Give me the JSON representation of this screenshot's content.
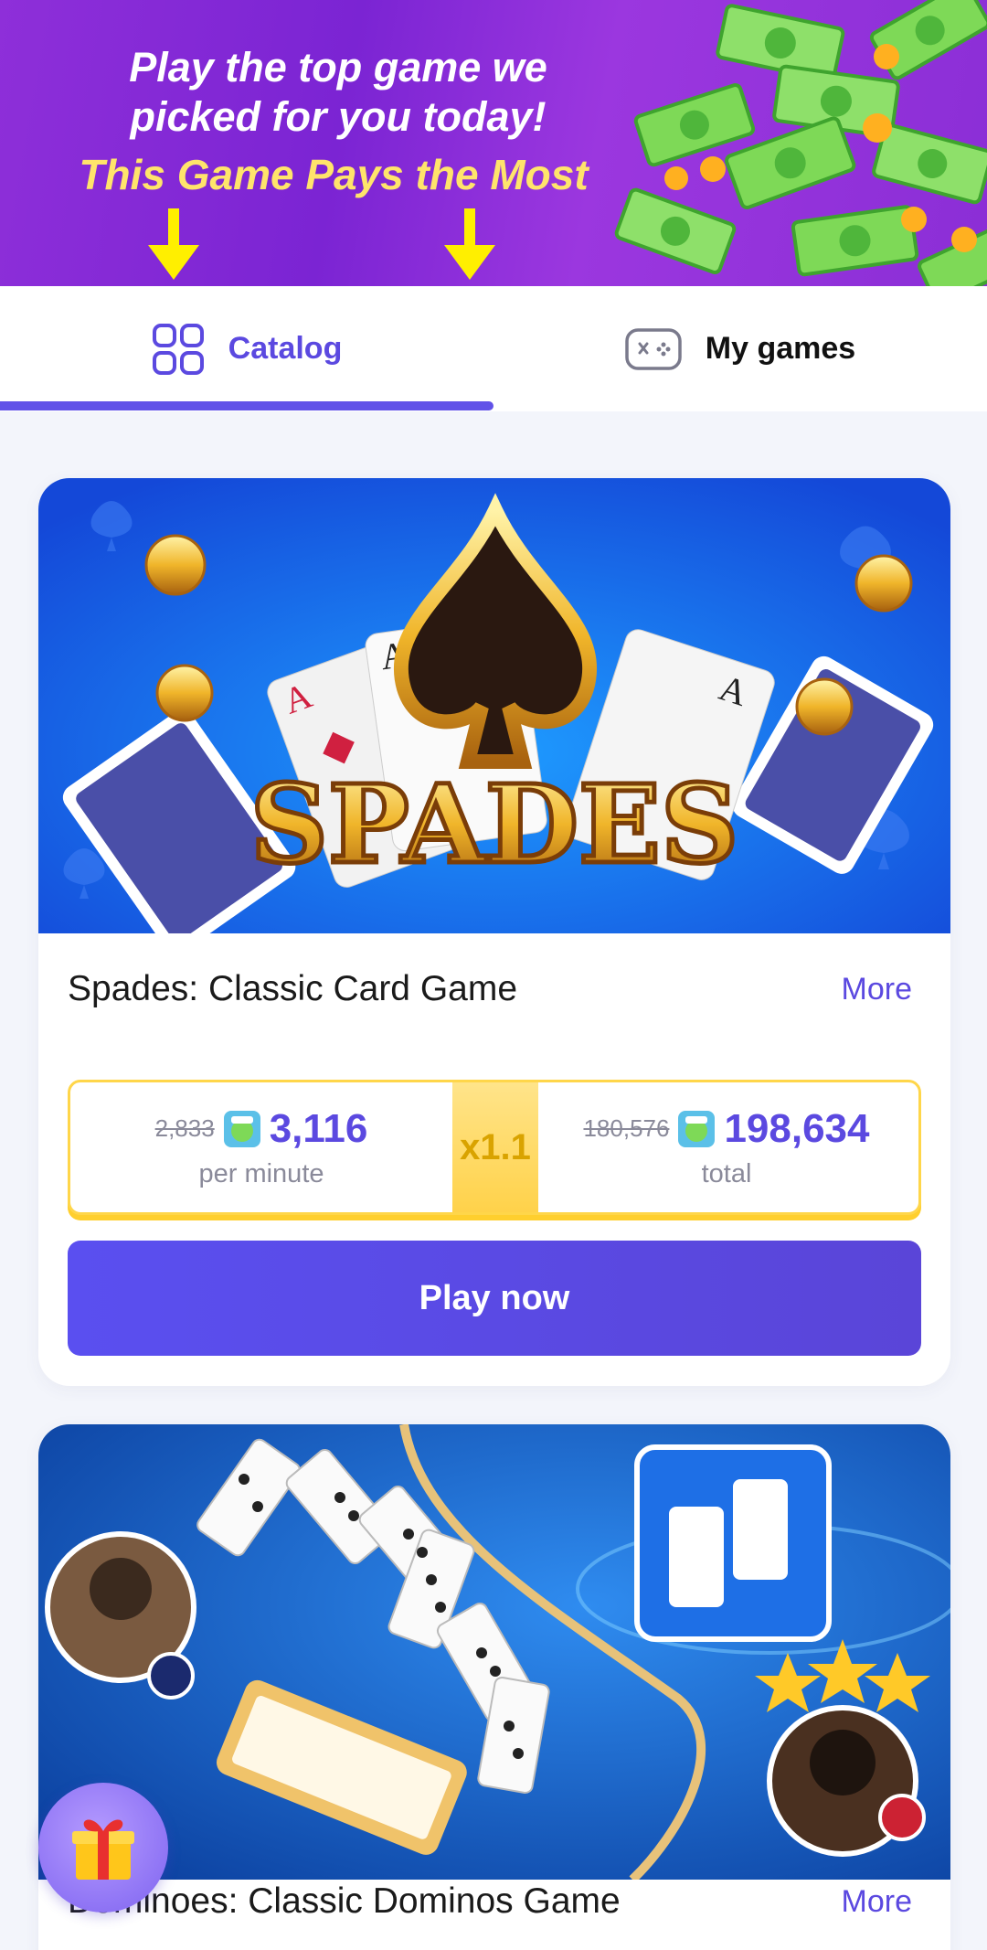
{
  "banner": {
    "line1": "Play the top game we",
    "line2": "picked for you today!",
    "line3": "This Game Pays the Most"
  },
  "tabs": [
    {
      "label": "Catalog",
      "icon": "grid-icon",
      "active": true
    },
    {
      "label": "My games",
      "icon": "gamepad-icon",
      "active": false
    }
  ],
  "games": [
    {
      "title": "Spades: Classic Card Game",
      "more_label": "More",
      "image_text": "SPADES",
      "per_minute_old": "2,833",
      "per_minute_new": "3,116",
      "per_minute_label": "per minute",
      "multiplier": "x1.1",
      "total_old": "180,576",
      "total_new": "198,634",
      "total_label": "total",
      "play_label": "Play now"
    },
    {
      "title": "Dominoes: Classic Dominos Game",
      "more_label": "More"
    }
  ],
  "colors": {
    "accent": "#5b49e0",
    "banner": "#8e2fd9",
    "highlight": "#ffd64a"
  }
}
